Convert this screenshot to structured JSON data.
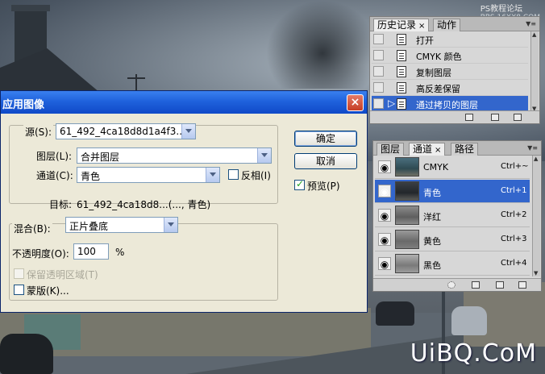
{
  "top_label": {
    "line1": "PS教程论坛",
    "line2": "BBS.16XX8.COM"
  },
  "watermark": "UiBQ.CoM",
  "dialog": {
    "title": "应用图像",
    "close": "×",
    "source_label": "源(S):",
    "source_value": "61_492_4ca18d8d1a4f3...",
    "layer_label": "图层(L):",
    "layer_value": "合并图层",
    "channel_label": "通道(C):",
    "channel_value": "青色",
    "invert_label": "反相(I)",
    "target_label": "目标:",
    "target_value": "61_492_4ca18d8...(..., 青色)",
    "blend_label": "混合(B):",
    "blend_value": "正片叠底",
    "opacity_label": "不透明度(O):",
    "opacity_value": "100",
    "opacity_unit": "%",
    "preserve_label": "保留透明区域(T)",
    "mask_label": "蒙版(K)...",
    "ok": "确定",
    "cancel": "取消",
    "preview_label": "预览(P)",
    "preview_checked": true,
    "invert_checked": false,
    "mask_checked": false
  },
  "history_panel": {
    "tabs": [
      "历史记录",
      "动作"
    ],
    "items": [
      "打开",
      "CMYK 颜色",
      "复制图层",
      "高反差保留",
      "通过拷贝的图层"
    ],
    "active_index": 4
  },
  "channels_panel": {
    "tabs": [
      "图层",
      "通道",
      "路径"
    ],
    "items": [
      {
        "name": "CMYK",
        "shortcut": "Ctrl+~"
      },
      {
        "name": "青色",
        "shortcut": "Ctrl+1"
      },
      {
        "name": "洋红",
        "shortcut": "Ctrl+2"
      },
      {
        "name": "黄色",
        "shortcut": "Ctrl+3"
      },
      {
        "name": "黑色",
        "shortcut": "Ctrl+4"
      }
    ],
    "active_index": 1
  },
  "icons": {
    "close": "close-icon",
    "eye": "eye-icon",
    "dropdown": "chevron-down-icon"
  }
}
